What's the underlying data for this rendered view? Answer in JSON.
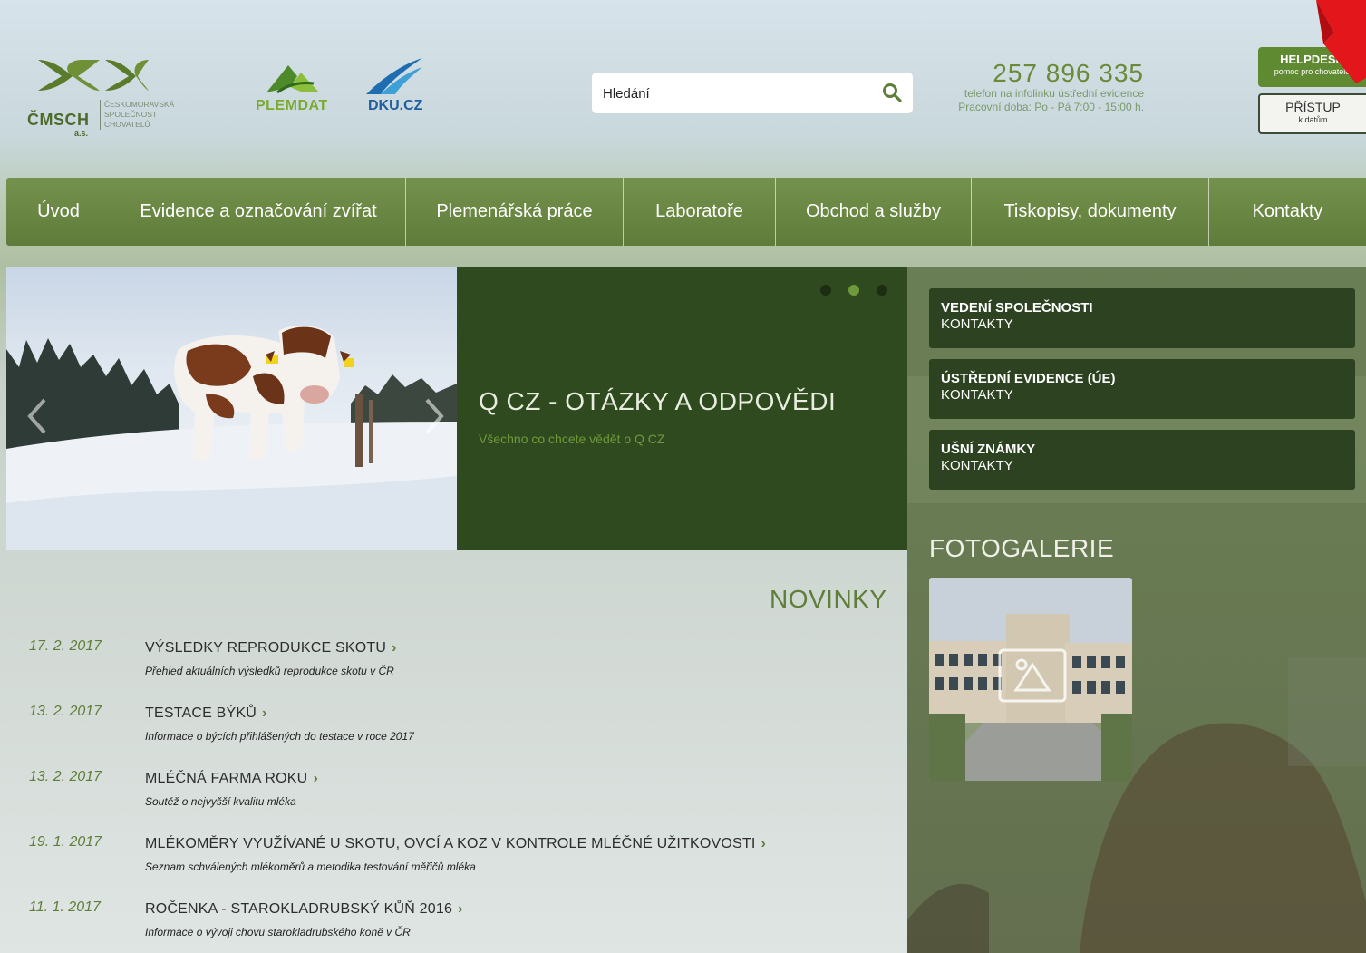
{
  "header": {
    "logo_cmsch": {
      "name": "ČMSCH",
      "suffix": "a.s.",
      "sub_lines": [
        "ČESKOMORAVSKÁ",
        "SPOLEČNOST",
        "CHOVATELŮ"
      ]
    },
    "logo_plemdat": "PLEMDAT",
    "logo_dku": "DKU.CZ",
    "search": {
      "placeholder": "Hledání",
      "icon": "search-icon"
    },
    "phone": {
      "number": "257 896 335",
      "line1": "telefon na infolinku ústřední evidence",
      "line2": "Pracovní doba: Po - Pá 7:00 - 15:00 h."
    },
    "helpdesk": {
      "title": "HELPDESK",
      "subtitle": "pomoc pro chovatele"
    },
    "access": {
      "title": "PŘÍSTUP",
      "subtitle": "k datům"
    }
  },
  "nav": [
    "Úvod",
    "Evidence a označování zvířat",
    "Plemenářská práce",
    "Laboratoře",
    "Obchod a služby",
    "Tiskopisy, dokumenty",
    "Kontakty"
  ],
  "slider": {
    "title": "Q CZ - OTÁZKY A ODPOVĚDI",
    "subtitle": "Všechno co chcete vědět o Q CZ",
    "dots": 3,
    "active_dot": 2
  },
  "sidebar": {
    "boxes": [
      {
        "title": "VEDENÍ SPOLEČNOSTI",
        "subtitle": "KONTAKTY"
      },
      {
        "title": "ÚSTŘEDNÍ EVIDENCE (ÚE)",
        "subtitle": "KONTAKTY"
      },
      {
        "title": "UŠNÍ ZNÁMKY",
        "subtitle": "KONTAKTY"
      }
    ],
    "gallery_title": "FOTOGALERIE"
  },
  "news": {
    "heading": "NOVINKY",
    "items": [
      {
        "date": "17. 2. 2017",
        "title": "VÝSLEDKY REPRODUKCE SKOTU",
        "desc": "Přehled aktuálních výsledků reprodukce skotu v ČR"
      },
      {
        "date": "13. 2. 2017",
        "title": "TESTACE BÝKŮ",
        "desc": "Informace o býcích přihlášených do testace v roce 2017"
      },
      {
        "date": "13. 2. 2017",
        "title": "MLÉČNÁ FARMA ROKU",
        "desc": "Soutěž o nejvyšší kvalitu mléka"
      },
      {
        "date": "19. 1. 2017",
        "title": "MLÉKOMĚRY VYUŽÍVANÉ U SKOTU, OVCÍ A KOZ V KONTROLE MLÉČNÉ UŽITKOVOSTI",
        "desc": "Seznam schválených mlékoměrů a metodika testování měřičů mléka"
      },
      {
        "date": "11. 1. 2017",
        "title": "ROČENKA - STAROKLADRUBSKÝ KŮŇ 2016",
        "desc": "Informace o vývoji chovu starokladrubského koně v ČR"
      }
    ]
  },
  "colors": {
    "brand_green": "#5f8a32",
    "dark_green": "#2f4a1e",
    "accent_text": "#5e7e39"
  }
}
